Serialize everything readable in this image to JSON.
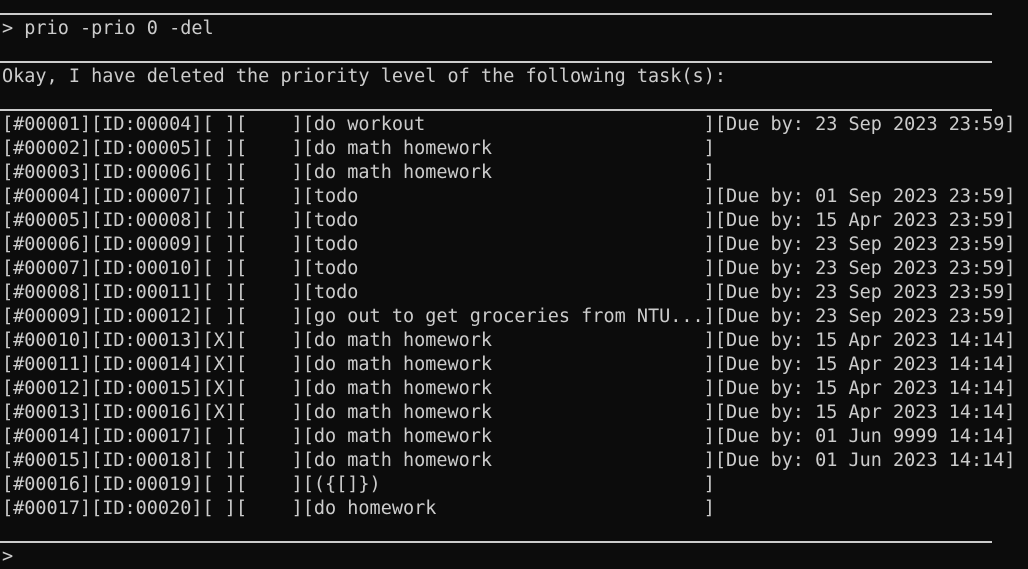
{
  "command": {
    "prompt_symbol": ">",
    "text": "prio -prio 0 -del"
  },
  "response": {
    "message": "Okay, I have deleted the priority level of the following task(s):"
  },
  "tasks": [
    {
      "line": "[#00001][ID:00004][ ][    ][do workout                         ][Due by: 23 Sep 2023 23:59]"
    },
    {
      "line": "[#00002][ID:00005][ ][    ][do math homework                   ]"
    },
    {
      "line": "[#00003][ID:00006][ ][    ][do math homework                   ]"
    },
    {
      "line": "[#00004][ID:00007][ ][    ][todo                               ][Due by: 01 Sep 2023 23:59]"
    },
    {
      "line": "[#00005][ID:00008][ ][    ][todo                               ][Due by: 15 Apr 2023 23:59]"
    },
    {
      "line": "[#00006][ID:00009][ ][    ][todo                               ][Due by: 23 Sep 2023 23:59]"
    },
    {
      "line": "[#00007][ID:00010][ ][    ][todo                               ][Due by: 23 Sep 2023 23:59]"
    },
    {
      "line": "[#00008][ID:00011][ ][    ][todo                               ][Due by: 23 Sep 2023 23:59]"
    },
    {
      "line": "[#00009][ID:00012][ ][    ][go out to get groceries from NTU...][Due by: 23 Sep 2023 23:59]"
    },
    {
      "line": "[#00010][ID:00013][X][    ][do math homework                   ][Due by: 15 Apr 2023 14:14]"
    },
    {
      "line": "[#00011][ID:00014][X][    ][do math homework                   ][Due by: 15 Apr 2023 14:14]"
    },
    {
      "line": "[#00012][ID:00015][X][    ][do math homework                   ][Due by: 15 Apr 2023 14:14]"
    },
    {
      "line": "[#00013][ID:00016][X][    ][do math homework                   ][Due by: 15 Apr 2023 14:14]"
    },
    {
      "line": "[#00014][ID:00017][ ][    ][do math homework                   ][Due by: 01 Jun 9999 14:14]"
    },
    {
      "line": "[#00015][ID:00018][ ][    ][do math homework                   ][Due by: 01 Jun 2023 14:14]"
    },
    {
      "line": "[#00016][ID:00019][ ][    ][({[]})                             ]"
    },
    {
      "line": "[#00017][ID:00020][ ][    ][do homework                        ]"
    }
  ],
  "input": {
    "prompt_symbol": ">",
    "value": ""
  }
}
